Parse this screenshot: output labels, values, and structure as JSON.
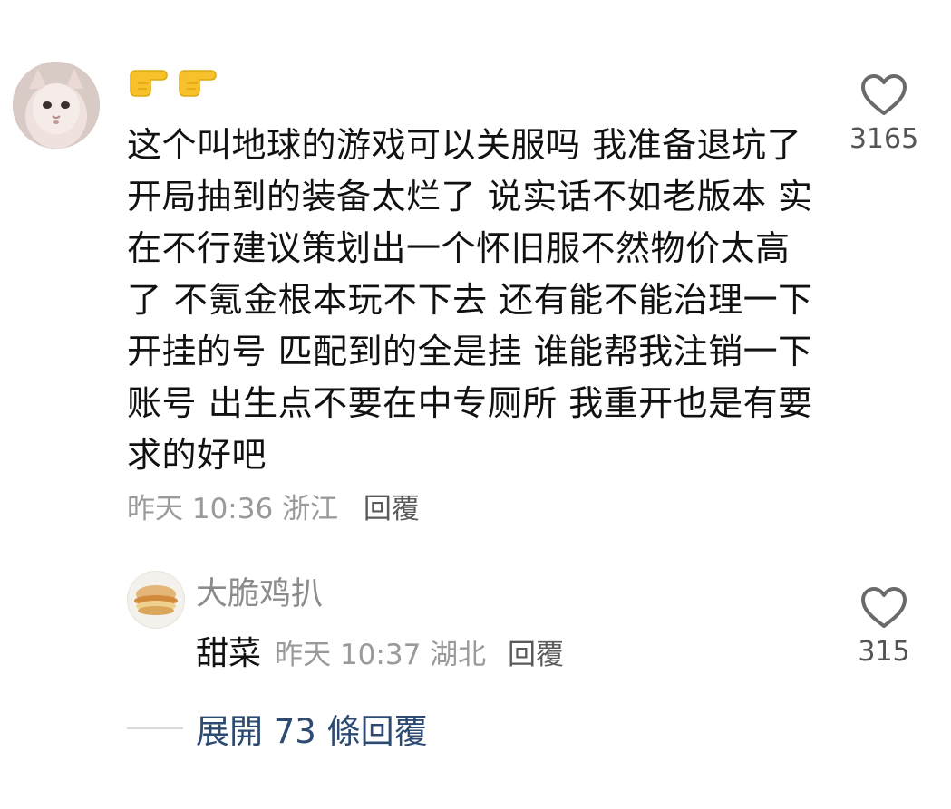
{
  "comment": {
    "emoji": "👉👉",
    "text": "这个叫地球的游戏可以关服吗 我准备退坑了 开局抽到的装备太烂了 说实话不如老版本 实在不行建议策划出一个怀旧服不然物价太高了 不氪金根本玩不下去 还有能不能治理一下开挂的号 匹配到的全是挂 谁能帮我注销一下账号 出生点不要在中专厕所 我重开也是有要求的好吧",
    "time": "昨天 10:36",
    "location": "浙江",
    "reply_label": "回覆",
    "likes": "3165"
  },
  "reply": {
    "username": "大脆鸡扒",
    "text": "甜菜",
    "time": "昨天 10:37",
    "location": "湖北",
    "reply_label": "回覆",
    "likes": "315"
  },
  "expand": {
    "label": "展開 73 條回覆"
  },
  "colors": {
    "text": "#111111",
    "meta": "#9a9a9a",
    "expand": "#2d4a72"
  }
}
